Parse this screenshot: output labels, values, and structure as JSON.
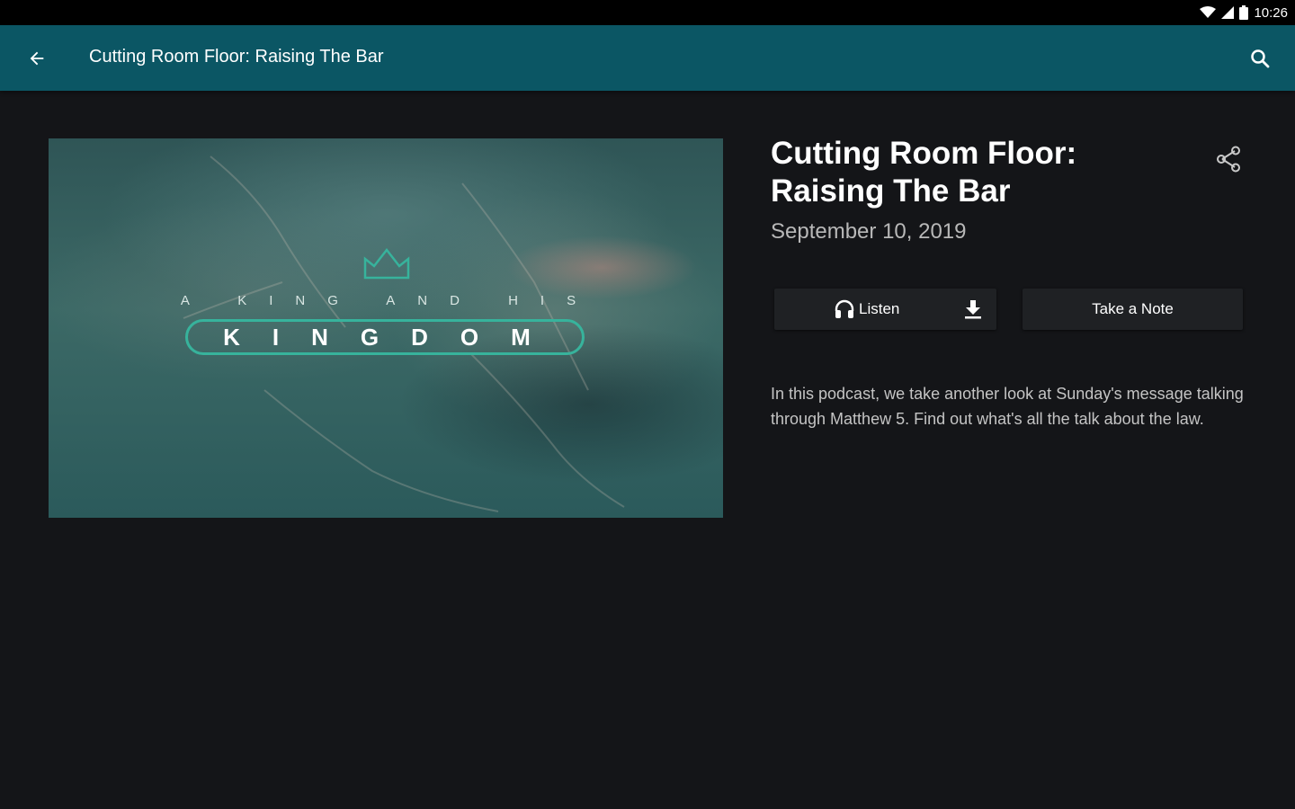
{
  "status_bar": {
    "time": "10:26",
    "icons": [
      "wifi-icon",
      "cellular-icon",
      "battery-icon"
    ]
  },
  "app_bar": {
    "title": "Cutting Room Floor: Raising The Bar",
    "back_icon": "arrow-left-icon",
    "search_icon": "search-icon",
    "background": "#0b5664"
  },
  "artwork": {
    "subtitle": "A KING AND HIS",
    "title": "KINGDOM",
    "accent": "#37b39c"
  },
  "episode": {
    "title": "Cutting Room Floor: Raising The Bar",
    "date": "September 10, 2019",
    "description": "In this podcast, we take another look at Sunday's message talking through Matthew 5. Find out what's all the talk about the law."
  },
  "actions": {
    "listen_label": "Listen",
    "listen_icon": "headphones-icon",
    "download_icon": "download-icon",
    "note_label": "Take a Note",
    "share_icon": "share-icon"
  }
}
